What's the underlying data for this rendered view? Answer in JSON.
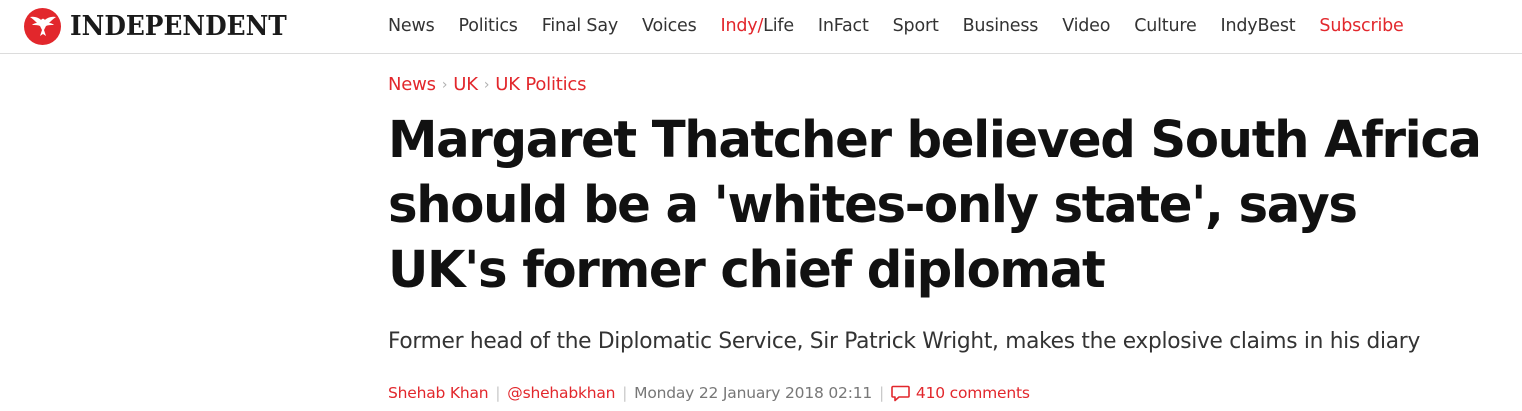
{
  "header": {
    "logo_text": "INDEPENDENT",
    "nav": {
      "news": "News",
      "politics": "Politics",
      "final_say": "Final Say",
      "voices": "Voices",
      "indy_prefix": "Indy/",
      "indy_suffix": "Life",
      "infact": "InFact",
      "sport": "Sport",
      "business": "Business",
      "video": "Video",
      "culture": "Culture",
      "indybest": "IndyBest",
      "subscribe": "Subscribe"
    }
  },
  "breadcrumb": {
    "items": [
      "News",
      "UK",
      "UK Politics"
    ],
    "separator": "›"
  },
  "article": {
    "headline": "Margaret Thatcher believed South Africa should be a 'whites-only state', says UK's former chief diplomat",
    "standfirst": "Former head of the Diplomatic Service, Sir Patrick Wright, makes the explosive claims in his diary",
    "author": "Shehab Khan",
    "twitter": "@shehabkhan",
    "date": "Monday 22 January 2018 02:11",
    "comments": "410 comments"
  },
  "icons": {
    "logo": "eagle-icon",
    "comments": "comment-bubble-icon"
  },
  "colors": {
    "accent": "#e2272c",
    "text": "#111111",
    "muted": "#777777"
  }
}
